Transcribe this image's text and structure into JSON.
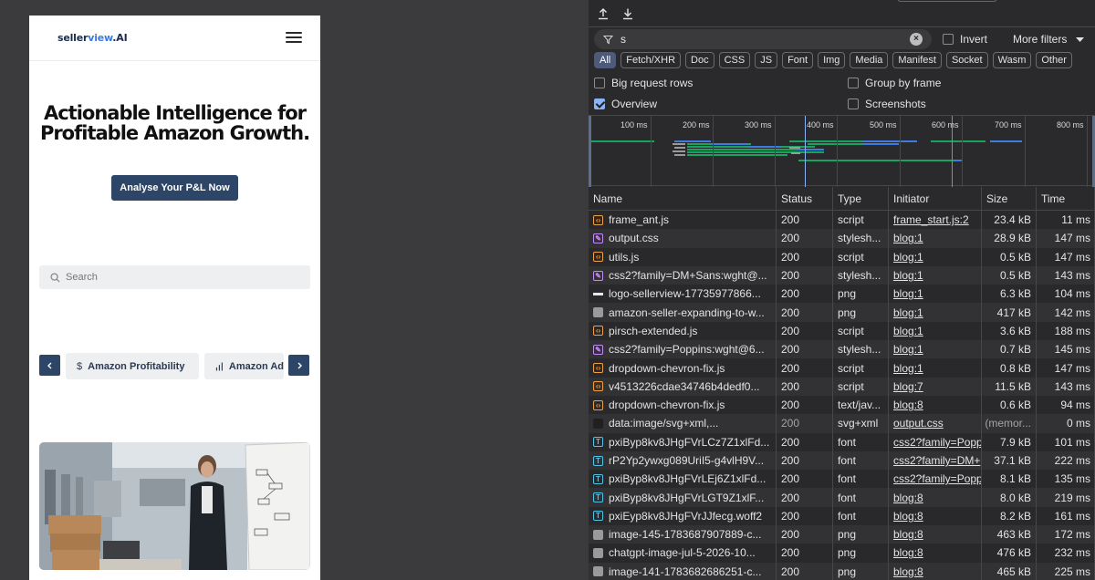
{
  "site": {
    "logo_main": "seller",
    "logo_accent": "view",
    "logo_suffix": ".AI",
    "hero_line1": "Actionable Intelligence for",
    "hero_line2": "Profitable Amazon Growth.",
    "cta_label": "Analyse Your P&L Now",
    "search_placeholder": "Search",
    "categories": [
      {
        "label": "Amazon Profitability",
        "icon": "dollar-icon"
      },
      {
        "label": "Amazon Ad",
        "icon": "bar-chart-icon"
      }
    ]
  },
  "devtools": {
    "filter_value": "s",
    "invert_label": "Invert",
    "more_filters_label": "More filters",
    "type_filters": [
      "All",
      "Fetch/XHR",
      "Doc",
      "CSS",
      "JS",
      "Font",
      "Img",
      "Media",
      "Manifest",
      "Socket",
      "Wasm",
      "Other"
    ],
    "options": {
      "big_request_rows": "Big request rows",
      "overview": "Overview",
      "group_by_frame": "Group by frame",
      "screenshots": "Screenshots"
    },
    "overview_ticks": [
      "100 ms",
      "200 ms",
      "300 ms",
      "400 ms",
      "500 ms",
      "600 ms",
      "700 ms",
      "800 ms"
    ],
    "columns": {
      "name": "Name",
      "status": "Status",
      "type": "Type",
      "initiator": "Initiator",
      "size": "Size",
      "time": "Time"
    },
    "rows": [
      {
        "icon": "script",
        "name": "frame_ant.js",
        "status": "200",
        "type": "script",
        "initiator": "frame_start.js:2",
        "size": "23.4 kB",
        "time": "11 ms"
      },
      {
        "icon": "style",
        "name": "output.css",
        "status": "200",
        "type": "stylesh...",
        "initiator": "blog:1",
        "size": "28.9 kB",
        "time": "147 ms"
      },
      {
        "icon": "script",
        "name": "utils.js",
        "status": "200",
        "type": "script",
        "initiator": "blog:1",
        "size": "0.5 kB",
        "time": "147 ms"
      },
      {
        "icon": "style",
        "name": "css2?family=DM+Sans:wght@...",
        "status": "200",
        "type": "stylesh...",
        "initiator": "blog:1",
        "size": "0.5 kB",
        "time": "143 ms"
      },
      {
        "icon": "logo",
        "name": "logo-sellerview-17735977866...",
        "status": "200",
        "type": "png",
        "initiator": "blog:1",
        "size": "6.3 kB",
        "time": "104 ms"
      },
      {
        "icon": "img",
        "name": "amazon-seller-expanding-to-w...",
        "status": "200",
        "type": "png",
        "initiator": "blog:1",
        "size": "417 kB",
        "time": "142 ms"
      },
      {
        "icon": "script",
        "name": "pirsch-extended.js",
        "status": "200",
        "type": "script",
        "initiator": "blog:1",
        "size": "3.6 kB",
        "time": "188 ms"
      },
      {
        "icon": "style",
        "name": "css2?family=Poppins:wght@6...",
        "status": "200",
        "type": "stylesh...",
        "initiator": "blog:1",
        "size": "0.7 kB",
        "time": "145 ms"
      },
      {
        "icon": "script",
        "name": "dropdown-chevron-fix.js",
        "status": "200",
        "type": "script",
        "initiator": "blog:1",
        "size": "0.8 kB",
        "time": "147 ms"
      },
      {
        "icon": "script",
        "name": "v4513226cdae34746b4dedf0...",
        "status": "200",
        "type": "script",
        "initiator": "blog:7",
        "size": "11.5 kB",
        "time": "143 ms"
      },
      {
        "icon": "script",
        "name": "dropdown-chevron-fix.js",
        "status": "200",
        "type": "text/jav...",
        "initiator": "blog:8",
        "size": "0.6 kB",
        "time": "94 ms"
      },
      {
        "icon": "data",
        "name": "data:image/svg+xml,...",
        "status": "200",
        "type": "svg+xml",
        "initiator": "output.css",
        "size": "(memor...",
        "time": "0 ms",
        "dim": true
      },
      {
        "icon": "font",
        "name": "pxiByp8kv8JHgFVrLCz7Z1xlFd...",
        "status": "200",
        "type": "font",
        "initiator": "css2?family=Popp",
        "size": "7.9 kB",
        "time": "101 ms"
      },
      {
        "icon": "font",
        "name": "rP2Yp2ywxg089UriI5-g4vlH9V...",
        "status": "200",
        "type": "font",
        "initiator": "css2?family=DM+",
        "size": "37.1 kB",
        "time": "222 ms"
      },
      {
        "icon": "font",
        "name": "pxiByp8kv8JHgFVrLEj6Z1xlFd...",
        "status": "200",
        "type": "font",
        "initiator": "css2?family=Popp",
        "size": "8.1 kB",
        "time": "135 ms"
      },
      {
        "icon": "font",
        "name": "pxiByp8kv8JHgFVrLGT9Z1xlF...",
        "status": "200",
        "type": "font",
        "initiator": "blog:8",
        "size": "8.0 kB",
        "time": "219 ms"
      },
      {
        "icon": "font",
        "name": "pxiEyp8kv8JHgFVrJJfecg.woff2",
        "status": "200",
        "type": "font",
        "initiator": "blog:8",
        "size": "8.2 kB",
        "time": "161 ms"
      },
      {
        "icon": "img",
        "name": "image-145-1783687907889-c...",
        "status": "200",
        "type": "png",
        "initiator": "blog:8",
        "size": "463 kB",
        "time": "172 ms"
      },
      {
        "icon": "img",
        "name": "chatgpt-image-jul-5-2026-10...",
        "status": "200",
        "type": "png",
        "initiator": "blog:8",
        "size": "476 kB",
        "time": "232 ms"
      },
      {
        "icon": "img",
        "name": "image-141-1783682686251-c...",
        "status": "200",
        "type": "png",
        "initiator": "blog:8",
        "size": "465 kB",
        "time": "225 ms"
      }
    ]
  }
}
